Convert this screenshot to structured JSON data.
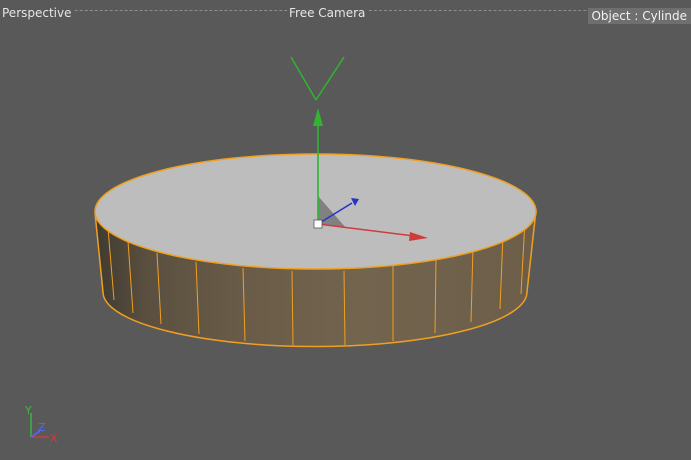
{
  "viewport": {
    "view_name": "Perspective",
    "camera_name": "Free Camera",
    "object_label": "Object : Cylinde"
  },
  "scene": {
    "object": "cylinder",
    "selection_color": "#f5a623",
    "cap_color": "#bdbdbd",
    "side_color": "#6f5f48"
  },
  "axis_indicator": {
    "y_label": "Y",
    "z_label": "Z",
    "x_label": "X",
    "y_color": "#3cba3c",
    "z_color": "#4a6cff",
    "x_color": "#d23b3b"
  },
  "icons": [
    "move-gizmo-icon",
    "axis-orientation-icon"
  ]
}
